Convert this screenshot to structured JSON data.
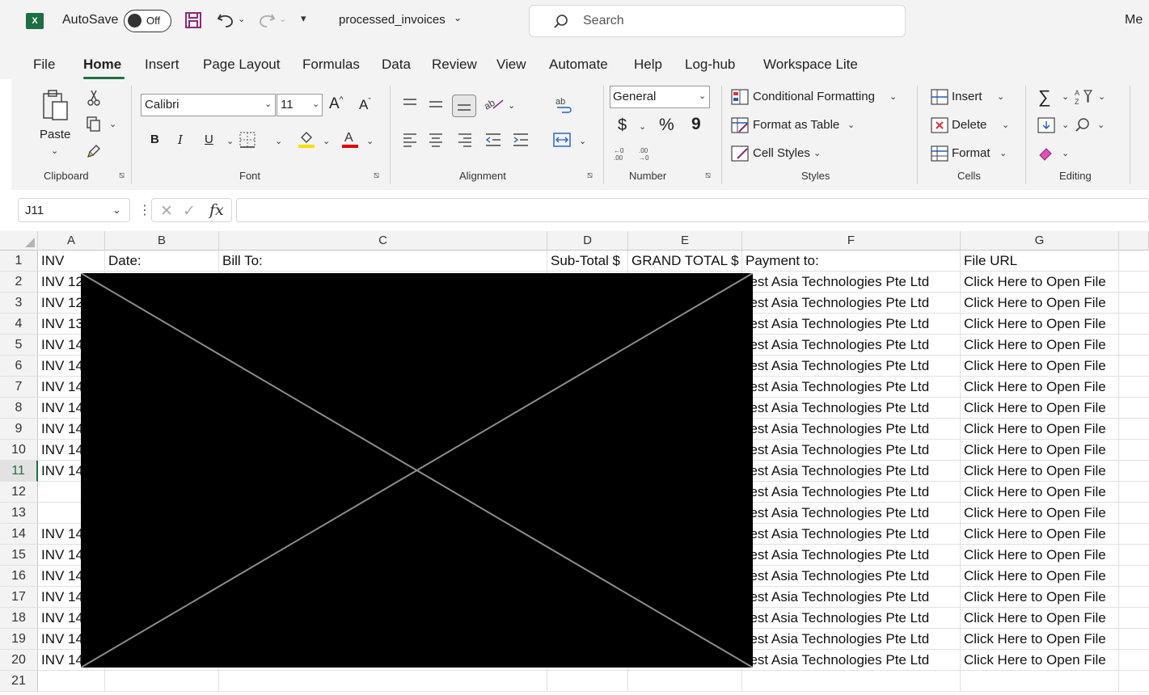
{
  "titlebar": {
    "logo_letter": "X",
    "autosave_label": "AutoSave",
    "autosave_state": "Off",
    "filename": "processed_invoices",
    "search_placeholder": "Search",
    "user_truncated": "Me"
  },
  "tabs": [
    {
      "label": "File"
    },
    {
      "label": "Home",
      "active": true
    },
    {
      "label": "Insert"
    },
    {
      "label": "Page Layout"
    },
    {
      "label": "Formulas"
    },
    {
      "label": "Data"
    },
    {
      "label": "Review"
    },
    {
      "label": "View"
    },
    {
      "label": "Automate"
    },
    {
      "label": "Help"
    },
    {
      "label": "Log-hub"
    },
    {
      "label": "Workspace Lite"
    }
  ],
  "ribbon": {
    "clipboard": {
      "paste": "Paste",
      "group": "Clipboard"
    },
    "font": {
      "name": "Calibri",
      "size": "11",
      "bold": "B",
      "italic": "I",
      "underline": "U",
      "group": "Font"
    },
    "alignment": {
      "group": "Alignment"
    },
    "number": {
      "format": "General",
      "currency": "$",
      "percent": "%",
      "comma": "9",
      "group": "Number"
    },
    "styles": {
      "conditional": "Conditional Formatting",
      "format_table": "Format as Table",
      "cell_styles": "Cell Styles",
      "group": "Styles"
    },
    "cells": {
      "insert": "Insert",
      "delete": "Delete",
      "format": "Format",
      "group": "Cells"
    },
    "editing": {
      "group": "Editing"
    }
  },
  "formula_bar": {
    "name_box": "J11",
    "formula": ""
  },
  "sheet": {
    "columns": [
      "A",
      "B",
      "C",
      "D",
      "E",
      "F",
      "G"
    ],
    "header_row": [
      "INV",
      "Date:",
      "Bill To:",
      "Sub-Total $",
      "GRAND TOTAL $",
      "Payment to:",
      "File URL"
    ],
    "selected_row": 11,
    "rows": [
      {
        "n": "1"
      },
      {
        "n": "2",
        "a": "INV 12",
        "f": "uest Asia Technologies Pte Ltd",
        "g": "Click Here to Open File"
      },
      {
        "n": "3",
        "a": "INV 12",
        "f": "uest Asia Technologies Pte Ltd",
        "g": "Click Here to Open File"
      },
      {
        "n": "4",
        "a": "INV 13",
        "f": "uest Asia Technologies Pte Ltd",
        "g": "Click Here to Open File"
      },
      {
        "n": "5",
        "a": "INV 14",
        "f": "uest Asia Technologies Pte Ltd",
        "g": "Click Here to Open File"
      },
      {
        "n": "6",
        "a": "INV 14",
        "f": "uest Asia Technologies Pte Ltd",
        "g": "Click Here to Open File"
      },
      {
        "n": "7",
        "a": "INV 14",
        "f": "uest Asia Technologies Pte Ltd",
        "g": "Click Here to Open File"
      },
      {
        "n": "8",
        "a": "INV 14",
        "f": "uest Asia Technologies Pte Ltd",
        "g": "Click Here to Open File"
      },
      {
        "n": "9",
        "a": "INV 14",
        "f": "uest Asia Technologies Pte Ltd",
        "g": "Click Here to Open File"
      },
      {
        "n": "10",
        "a": "INV 14",
        "f": "uest Asia Technologies Pte Ltd",
        "g": "Click Here to Open File"
      },
      {
        "n": "11",
        "a": "INV 14",
        "f": "uest Asia Technologies Pte Ltd",
        "g": "Click Here to Open File"
      },
      {
        "n": "12",
        "a": "",
        "f": "uest Asia Technologies Pte Ltd",
        "g": "Click Here to Open File"
      },
      {
        "n": "13",
        "a": "",
        "f": "uest Asia Technologies Pte Ltd",
        "g": "Click Here to Open File"
      },
      {
        "n": "14",
        "a": "INV 14",
        "f": "uest Asia Technologies Pte Ltd",
        "g": "Click Here to Open File"
      },
      {
        "n": "15",
        "a": "INV 14",
        "f": "uest Asia Technologies Pte Ltd",
        "g": "Click Here to Open File"
      },
      {
        "n": "16",
        "a": "INV 14",
        "f": "uest Asia Technologies Pte Ltd",
        "g": "Click Here to Open File"
      },
      {
        "n": "17",
        "a": "INV 14",
        "f": "uest Asia Technologies Pte Ltd",
        "g": "Click Here to Open File"
      },
      {
        "n": "18",
        "a": "INV 14",
        "f": "uest Asia Technologies Pte Ltd",
        "g": "Click Here to Open File"
      },
      {
        "n": "19",
        "a": "INV 14",
        "f": "uest Asia Technologies Pte Ltd",
        "g": "Click Here to Open File"
      },
      {
        "n": "20",
        "a": "INV 14",
        "f": "uest Asia Technologies Pte Ltd",
        "g": "Click Here to Open File"
      },
      {
        "n": "21"
      }
    ]
  },
  "colors": {
    "accent": "#1d6f42",
    "chrome": "#f3f3f3",
    "redaction": "#000000"
  }
}
